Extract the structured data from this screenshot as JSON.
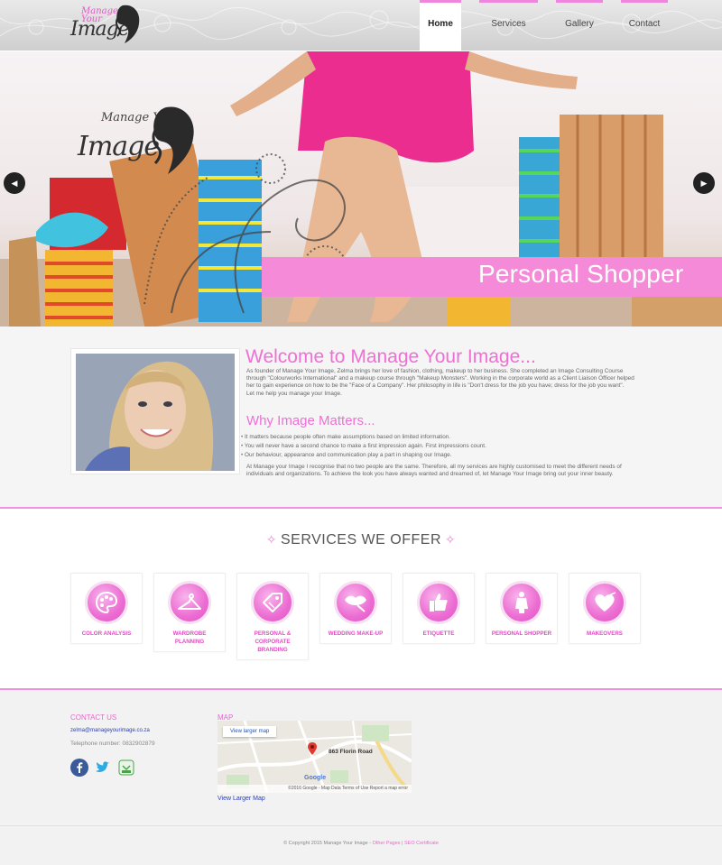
{
  "header": {
    "logo_small": "Manage Your",
    "logo_large": "Image",
    "nav": [
      {
        "label": "Home",
        "active": true
      },
      {
        "label": "Services",
        "active": false
      },
      {
        "label": "Gallery",
        "active": false
      },
      {
        "label": "Contact",
        "active": false
      }
    ]
  },
  "banner": {
    "logo_small": "Manage Your",
    "logo_large": "Image",
    "caption": "Personal Shopper",
    "prev_label": "◀",
    "next_label": "▶"
  },
  "welcome": {
    "title": "Welcome to Manage Your Image...",
    "text": "As founder of Manage Your Image, Zelma brings her love of fashion, clothing, makeup to her business.  She completed an Image Consulting Course through \"Colourworks International\" and a makeup course through \"Makeup Monsters\".  Working in the corporate world as a Client Liaison Officer helped her to gain experience on how to be the \"Face of a Company\".  Her philosophy in life is \"Don't dress for the job you have; dress for the job you want\".",
    "text2": "Let me help you manage your Image.",
    "why_title": "Why Image Matters...",
    "why_items": [
      "It matters because people often make assumptions based on limited information.",
      "You will never have a second chance to make a first impression again.  First impressions count.",
      "Our behaviour, appearance and communication play a part in shaping our Image."
    ],
    "why_para": "At Manage your Image I recognise that no two people are the same.  Therefore, all my services are highly customised to meet the different needs of individuals and organizations.  To achieve the look you have always wanted and dreamed of, let Manage Your Image bring out your inner beauty."
  },
  "services": {
    "title": "SERVICES WE OFFER",
    "items": [
      {
        "label": "COLOR ANALYSIS",
        "icon": "palette-icon"
      },
      {
        "label": "WARDROBE PLANNING",
        "icon": "hanger-icon"
      },
      {
        "label": "PERSONAL & CORPORATE BRANDING",
        "icon": "tag-icon"
      },
      {
        "label": "WEDDING MAKE-UP",
        "icon": "lips-icon"
      },
      {
        "label": "ETIQUETTE",
        "icon": "thumbs-up-icon"
      },
      {
        "label": "PERSONAL SHOPPER",
        "icon": "person-icon"
      },
      {
        "label": "MAKEOVERS",
        "icon": "heart-icon"
      }
    ]
  },
  "footer": {
    "contact_title": "CONTACT US",
    "email": "zelma@manageyourimage.co.za",
    "phone": "Telephone number:  0832902879",
    "social": [
      "facebook-icon",
      "twitter-icon",
      "skype-icon"
    ],
    "map_title": "MAP",
    "map_button": "View larger map",
    "map_address": "863 Florin Road",
    "map_footer": "©2016 Google - Map Data   Terms of Use   Report a map error",
    "map_google": "Google",
    "view_larger_link": "View Larger Map",
    "copyright": "© Copyright 2015 Manage Your Image - ",
    "copyright_links": "Other Pages | SEO Certificate"
  },
  "colors": {
    "accent": "#f06fd5",
    "ribbon": "#f58ad8",
    "link": "#2b3fb3"
  }
}
